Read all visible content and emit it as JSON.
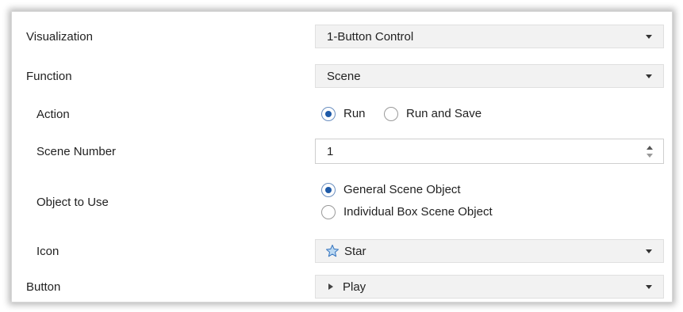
{
  "form": {
    "visualization": {
      "label": "Visualization",
      "value": "1-Button Control"
    },
    "function": {
      "label": "Function",
      "value": "Scene"
    },
    "action": {
      "label": "Action",
      "options": [
        "Run",
        "Run and Save"
      ],
      "selected": "Run"
    },
    "scene_number": {
      "label": "Scene Number",
      "value": "1"
    },
    "object_to_use": {
      "label": "Object to Use",
      "options": [
        "General Scene Object",
        "Individual Box Scene Object"
      ],
      "selected": "General Scene Object"
    },
    "icon": {
      "label": "Icon",
      "value": "Star",
      "icon": "star-icon"
    },
    "button": {
      "label": "Button",
      "value": "Play",
      "icon": "play-icon"
    }
  },
  "colors": {
    "radio_selected": "#1e5aa8",
    "star_fill": "#bcd9f2",
    "star_stroke": "#3a78c0"
  }
}
